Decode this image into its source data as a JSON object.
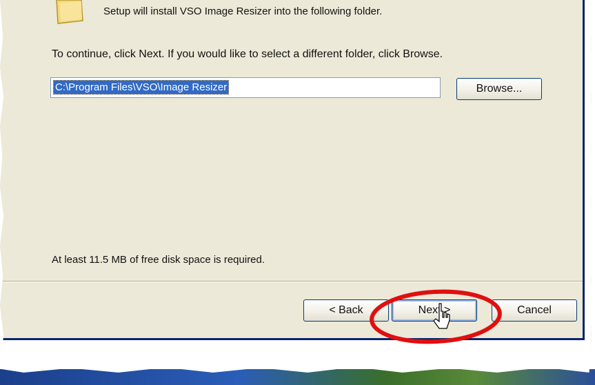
{
  "dialog": {
    "install_text": "Setup will install VSO Image Resizer into the following folder.",
    "instruction": "To continue, click Next. If you would like to select a different folder, click Browse.",
    "path_value": "C:\\Program Files\\VSO\\Image Resizer",
    "browse_label": "Browse...",
    "disk_space_text": "At least 11.5 MB of free disk space is required.",
    "back_label": "< Back",
    "next_label": "Next >",
    "cancel_label": "Cancel"
  },
  "annotation": {
    "highlight_color": "#e01010",
    "highlighted": "next-button"
  },
  "icons": {
    "folder": "folder-icon",
    "cursor": "pointer-cursor-icon"
  }
}
